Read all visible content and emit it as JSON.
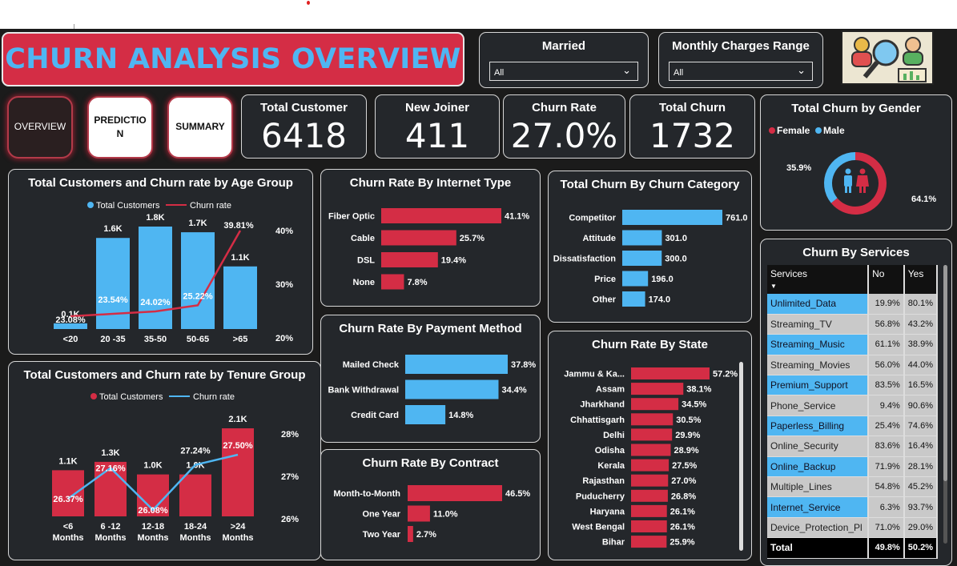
{
  "header": {
    "title": "CHURN ANALYSIS OVERVIEW",
    "slicers": [
      {
        "label": "Married",
        "value": "All"
      },
      {
        "label": "Monthly Charges Range",
        "value": "All"
      }
    ],
    "logo_icon": "analytics-magnifier-icon"
  },
  "nav": {
    "overview": "OVERVIEW",
    "prediction": "PREDICTIO\nN",
    "summary": "SUMMARY"
  },
  "kpis": [
    {
      "label": "Total Customer",
      "value": "6418"
    },
    {
      "label": "New Joiner",
      "value": "411"
    },
    {
      "label": "Churn Rate",
      "value": "27.0%"
    },
    {
      "label": "Total Churn",
      "value": "1732"
    }
  ],
  "colors": {
    "blue": "#4fb6f2",
    "red": "#d42d45",
    "panel": "#24272b",
    "background": "#1b1b1b"
  },
  "chart_data": [
    {
      "id": "age",
      "type": "bar",
      "title": "Total Customers and Churn rate by Age Group",
      "legend": [
        "Total Customers",
        "Churn rate"
      ],
      "legend_position": "top",
      "categories": [
        "<20",
        "20 -35",
        "35-50",
        "50-65",
        ">65"
      ],
      "series": [
        {
          "name": "Total Customers",
          "values": [
            100,
            1600,
            1800,
            1700,
            1100
          ],
          "labels": [
            "0.1K",
            "1.6K",
            "1.8K",
            "1.7K",
            "1.1K"
          ]
        },
        {
          "name": "Churn rate",
          "values": [
            23.08,
            23.54,
            24.02,
            25.22,
            39.81
          ],
          "labels": [
            "23.08%",
            "23.54%",
            "24.02%",
            "25.22%",
            "39.81%"
          ]
        }
      ],
      "y2_ticks": [
        "40%",
        "30%",
        "20%"
      ]
    },
    {
      "id": "tenure",
      "type": "bar",
      "title": "Total Customers and Churn rate by Tenure Group",
      "legend": [
        "Total Customers",
        "Churn rate"
      ],
      "legend_position": "top",
      "categories": [
        "<6\nMonths",
        "6 -12\nMonths",
        "12-18\nMonths",
        "18-24\nMonths",
        ">24\nMonths"
      ],
      "series": [
        {
          "name": "Total Customers",
          "values": [
            1100,
            1300,
            1000,
            1000,
            2100
          ],
          "labels": [
            "1.1K",
            "1.3K",
            "1.0K",
            "1.0K",
            "2.1K"
          ]
        },
        {
          "name": "Churn rate",
          "values": [
            26.37,
            27.16,
            26.08,
            27.24,
            27.5
          ],
          "labels": [
            "26.37%",
            "27.16%",
            "26.08%",
            "27.24%",
            "27.50%"
          ]
        }
      ],
      "y2_ticks": [
        "28%",
        "27%",
        "26%"
      ]
    },
    {
      "id": "internet",
      "type": "bar",
      "orientation": "horizontal",
      "title": "Churn Rate By Internet Type",
      "categories": [
        "Fiber Optic",
        "Cable",
        "DSL",
        "None"
      ],
      "values": [
        41.1,
        25.7,
        19.4,
        7.8
      ],
      "labels": [
        "41.1%",
        "25.7%",
        "19.4%",
        "7.8%"
      ]
    },
    {
      "id": "category",
      "type": "bar",
      "orientation": "horizontal",
      "title": "Total Churn By Churn Category",
      "categories": [
        "Competitor",
        "Attitude",
        "Dissatisfaction",
        "Price",
        "Other"
      ],
      "values": [
        761,
        301,
        300,
        196,
        174
      ],
      "labels": [
        "761.0",
        "301.0",
        "300.0",
        "196.0",
        "174.0"
      ]
    },
    {
      "id": "payment",
      "type": "bar",
      "orientation": "horizontal",
      "title": "Churn Rate By Payment Method",
      "categories": [
        "Mailed Check",
        "Bank Withdrawal",
        "Credit Card"
      ],
      "values": [
        37.8,
        34.4,
        14.8
      ],
      "labels": [
        "37.8%",
        "34.4%",
        "14.8%"
      ]
    },
    {
      "id": "contract",
      "type": "bar",
      "orientation": "horizontal",
      "title": "Churn Rate By Contract",
      "categories": [
        "Month-to-Month",
        "One Year",
        "Two Year"
      ],
      "values": [
        46.5,
        11.0,
        2.7
      ],
      "labels": [
        "46.5%",
        "11.0%",
        "2.7%"
      ]
    },
    {
      "id": "state",
      "type": "bar",
      "orientation": "horizontal",
      "title": "Churn Rate By State",
      "categories": [
        "Jammu & Ka...",
        "Assam",
        "Jharkhand",
        "Chhattisgarh",
        "Delhi",
        "Odisha",
        "Kerala",
        "Rajasthan",
        "Puducherry",
        "Haryana",
        "West Bengal",
        "Bihar"
      ],
      "values": [
        57.2,
        38.1,
        34.5,
        30.5,
        29.9,
        28.9,
        27.5,
        27.0,
        26.8,
        26.1,
        26.1,
        25.9
      ],
      "labels": [
        "57.2%",
        "38.1%",
        "34.5%",
        "30.5%",
        "29.9%",
        "28.9%",
        "27.5%",
        "27.0%",
        "26.8%",
        "26.1%",
        "26.1%",
        "25.9%"
      ]
    },
    {
      "id": "gender",
      "type": "pie",
      "title": "Total Churn by Gender",
      "legend": [
        "Female",
        "Male"
      ],
      "legend_position": "top-left",
      "values": [
        64.1,
        35.9
      ],
      "labels": [
        "64.1%",
        "35.9%"
      ]
    },
    {
      "id": "services",
      "type": "table",
      "title": "Churn By Services",
      "columns": [
        "Services",
        "No",
        "Yes"
      ],
      "rows": [
        {
          "service": "Unlimited_Data",
          "no": "19.9%",
          "yes": "80.1%",
          "style": "blue"
        },
        {
          "service": "Streaming_TV",
          "no": "56.8%",
          "yes": "43.2%",
          "style": "gray"
        },
        {
          "service": "Streaming_Music",
          "no": "61.1%",
          "yes": "38.9%",
          "style": "blue"
        },
        {
          "service": "Streaming_Movies",
          "no": "56.0%",
          "yes": "44.0%",
          "style": "gray"
        },
        {
          "service": "Premium_Support",
          "no": "83.5%",
          "yes": "16.5%",
          "style": "blue"
        },
        {
          "service": "Phone_Service",
          "no": "9.4%",
          "yes": "90.6%",
          "style": "gray"
        },
        {
          "service": "Paperless_Billing",
          "no": "25.4%",
          "yes": "74.6%",
          "style": "blue"
        },
        {
          "service": "Online_Security",
          "no": "83.6%",
          "yes": "16.4%",
          "style": "gray"
        },
        {
          "service": "Online_Backup",
          "no": "71.9%",
          "yes": "28.1%",
          "style": "blue"
        },
        {
          "service": "Multiple_Lines",
          "no": "54.8%",
          "yes": "45.2%",
          "style": "gray"
        },
        {
          "service": "Internet_Service",
          "no": "6.3%",
          "yes": "93.7%",
          "style": "blue"
        },
        {
          "service": "Device_Protection_Pl",
          "no": "71.0%",
          "yes": "29.0%",
          "style": "gray"
        }
      ],
      "total": {
        "service": "Total",
        "no": "49.8%",
        "yes": "50.2%"
      }
    }
  ]
}
